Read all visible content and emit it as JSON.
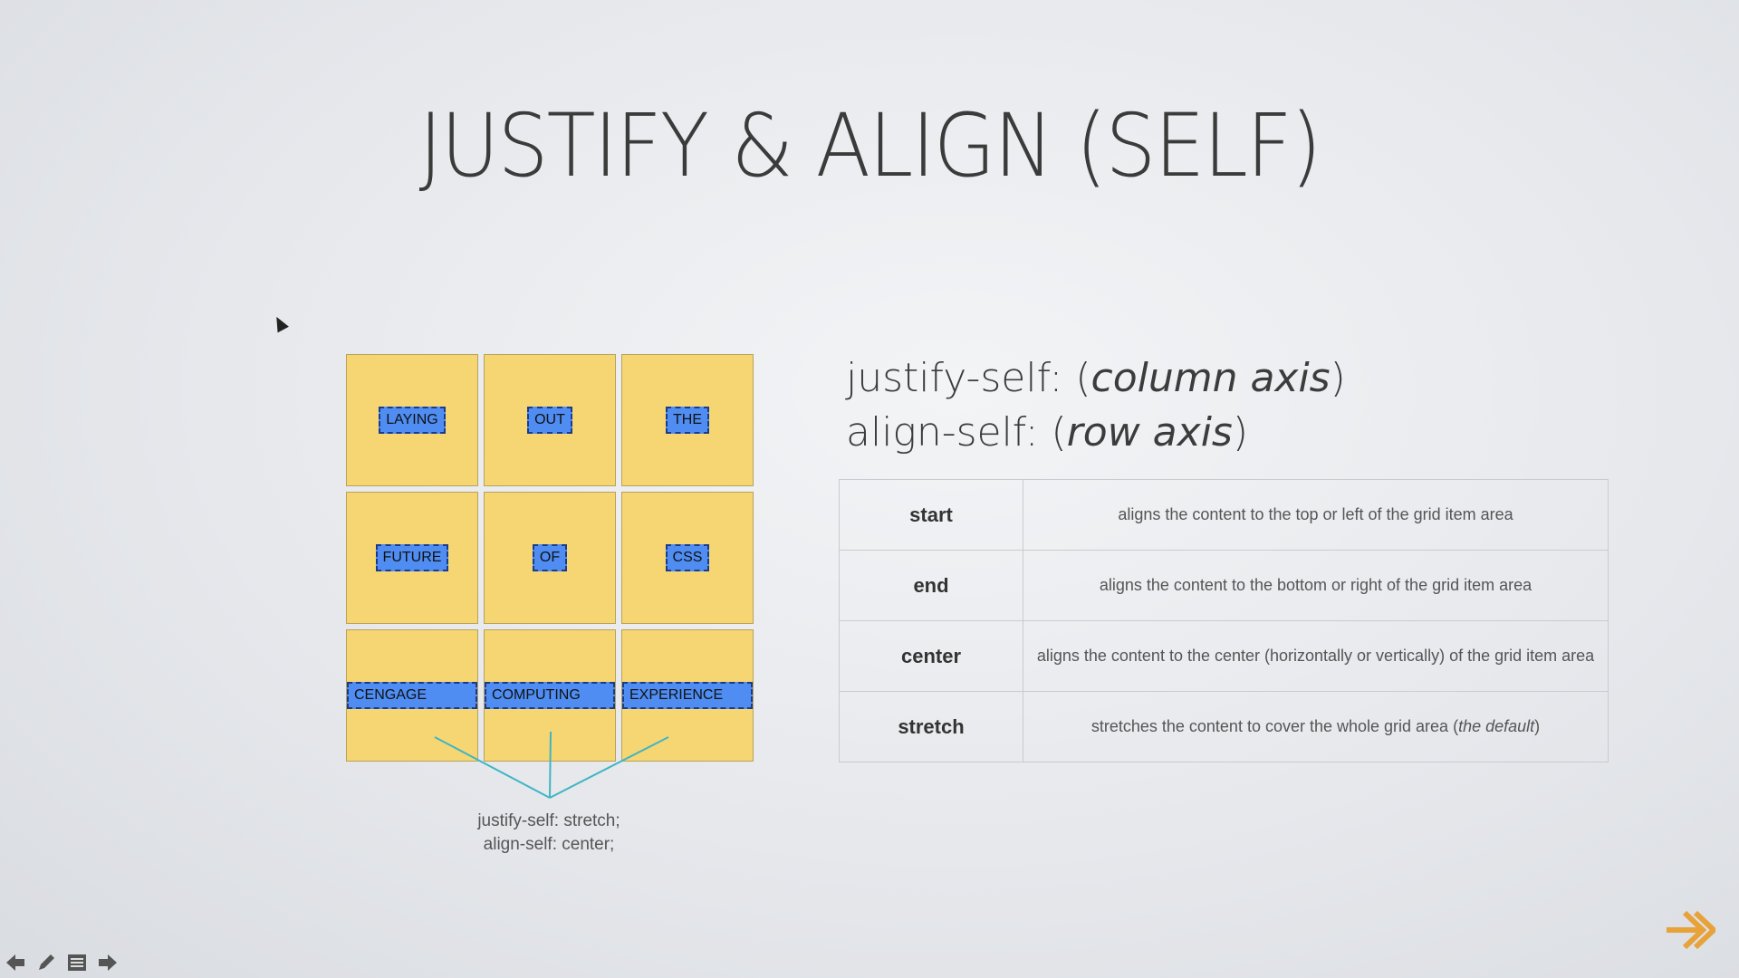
{
  "slide": {
    "title": "JUSTIFY & ALIGN (SELF)",
    "accent_color": "#e8a23a"
  },
  "grid": {
    "items": [
      "LAYING",
      "OUT",
      "THE",
      "FUTURE",
      "OF",
      "CSS",
      "CENGAGE",
      "COMPUTING",
      "EXPERIENCE"
    ],
    "caption_line1": "justify-self: stretch;",
    "caption_line2": "align-self: center;",
    "cell_color": "#f6d672",
    "tag_color": "#4f8df2"
  },
  "axes": {
    "justify_prefix": "justify-self: (",
    "justify_axis": "column axis",
    "justify_suffix": ")",
    "align_prefix": "align-self: (",
    "align_axis": "row axis",
    "align_suffix": ")"
  },
  "table": {
    "rows": [
      {
        "key": "start",
        "value": "aligns the content to the top or left of the grid item area"
      },
      {
        "key": "end",
        "value": "aligns the content to the bottom or right of the grid item area"
      },
      {
        "key": "center",
        "value": "aligns the content to the center (horizontally or vertically) of the grid item area"
      },
      {
        "key": "stretch",
        "value_prefix": "stretches the content to cover the whole grid area (",
        "value_em": "the default",
        "value_suffix": ")"
      }
    ]
  },
  "toolbar": {
    "icons": [
      "prev-arrow-icon",
      "pen-icon",
      "menu-icon",
      "next-arrow-icon"
    ]
  }
}
